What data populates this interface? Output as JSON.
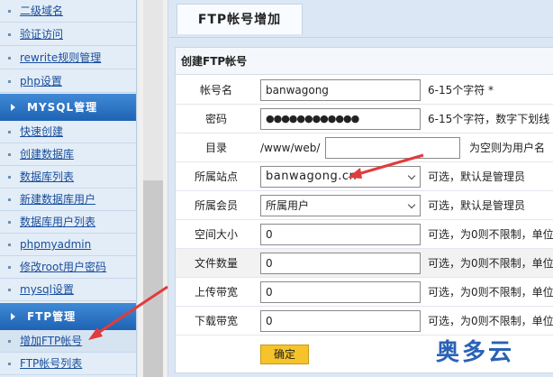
{
  "sidebar": {
    "items_top": [
      {
        "label": "二级域名"
      },
      {
        "label": "验证访问"
      },
      {
        "label": "rewrite规则管理"
      },
      {
        "label": "php设置"
      }
    ],
    "mysql_header": "MYSQL管理",
    "mysql_items": [
      {
        "label": "快速创建"
      },
      {
        "label": "创建数据库"
      },
      {
        "label": "数据库列表"
      },
      {
        "label": "新建数据库用户"
      },
      {
        "label": "数据库用户列表"
      },
      {
        "label": "phpmyadmin"
      },
      {
        "label": "修改root用户密码"
      },
      {
        "label": "mysql设置"
      }
    ],
    "ftp_header": "FTP管理",
    "ftp_items": [
      {
        "label": "增加FTP帐号"
      },
      {
        "label": "FTP帐号列表"
      }
    ]
  },
  "main": {
    "tab_title": "FTP帐号增加",
    "form_title": "创建FTP帐号",
    "fields": {
      "account": {
        "label": "帐号名",
        "value": "banwagong",
        "hint": "6-15个字符 *"
      },
      "password": {
        "label": "密码",
        "value": "●●●●●●●●●●●●",
        "hint": "6-15个字符，数字下划线"
      },
      "directory": {
        "label": "目录",
        "prefix": "/www/web/",
        "value": "",
        "hint": "为空则为用户名"
      },
      "site": {
        "label": "所属站点",
        "value": "banwagong.cn",
        "hint": "可选，默认是管理员"
      },
      "member": {
        "label": "所属会员",
        "value": "所属用户",
        "hint": "可选，默认是管理员"
      },
      "space": {
        "label": "空间大小",
        "value": "0",
        "hint": "可选，为0则不限制，单位"
      },
      "files": {
        "label": "文件数量",
        "value": "0",
        "hint": "可选，为0则不限制，单位"
      },
      "upload": {
        "label": "上传带宽",
        "value": "0",
        "hint": "可选，为0则不限制，单位"
      },
      "download": {
        "label": "下载带宽",
        "value": "0",
        "hint": "可选，为0则不限制，单位"
      }
    },
    "submit_label": "确定"
  },
  "watermark": "奥多云",
  "colors": {
    "accent": "#1f63b4",
    "annotation_arrow": "#e23b3b",
    "submit": "#f6c42a"
  }
}
